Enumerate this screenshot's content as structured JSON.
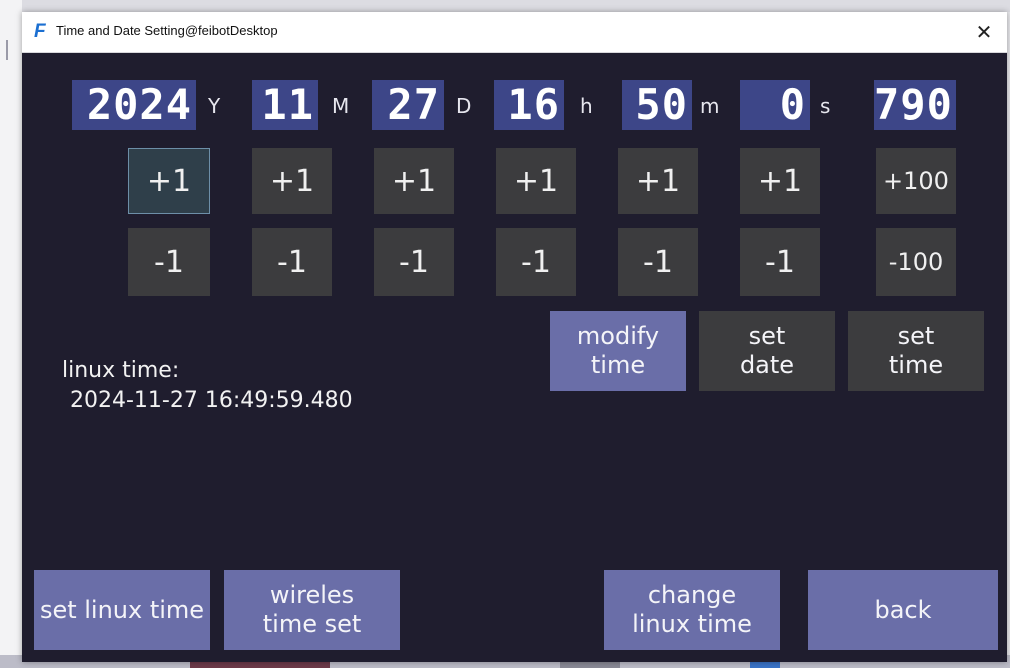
{
  "window": {
    "title": "Time and Date Setting@feibotDesktop",
    "logo_letter": "F",
    "close_glyph": "✕"
  },
  "clock": {
    "year": "2024",
    "year_unit": "Y",
    "month": "11",
    "month_unit": "M",
    "day": "27",
    "day_unit": "D",
    "hour": "16",
    "hour_unit": "h",
    "minute": "50",
    "minute_unit": "m",
    "second": "0",
    "second_unit": "s",
    "millis": "790"
  },
  "adjust": {
    "plus": [
      "+1",
      "+1",
      "+1",
      "+1",
      "+1",
      "+1",
      "+100"
    ],
    "minus": [
      "-1",
      "-1",
      "-1",
      "-1",
      "-1",
      "-1",
      "-100"
    ]
  },
  "actions": {
    "modify_time": "modify\ntime",
    "set_date": "set\ndate",
    "set_time": "set\ntime"
  },
  "linux_time": {
    "label": "linux time:",
    "value": "2024-11-27 16:49:59.480"
  },
  "footer": {
    "set_linux_time": "set linux time",
    "wireless_time_set": "wireles\ntime set",
    "change_linux_time": "change\nlinux time",
    "back": "back"
  },
  "colors": {
    "window_bg": "#1f1d2e",
    "lcd_bg": "#3d4688",
    "button_dark": "#3c3c3e",
    "button_blue": "#6a6ea8"
  }
}
